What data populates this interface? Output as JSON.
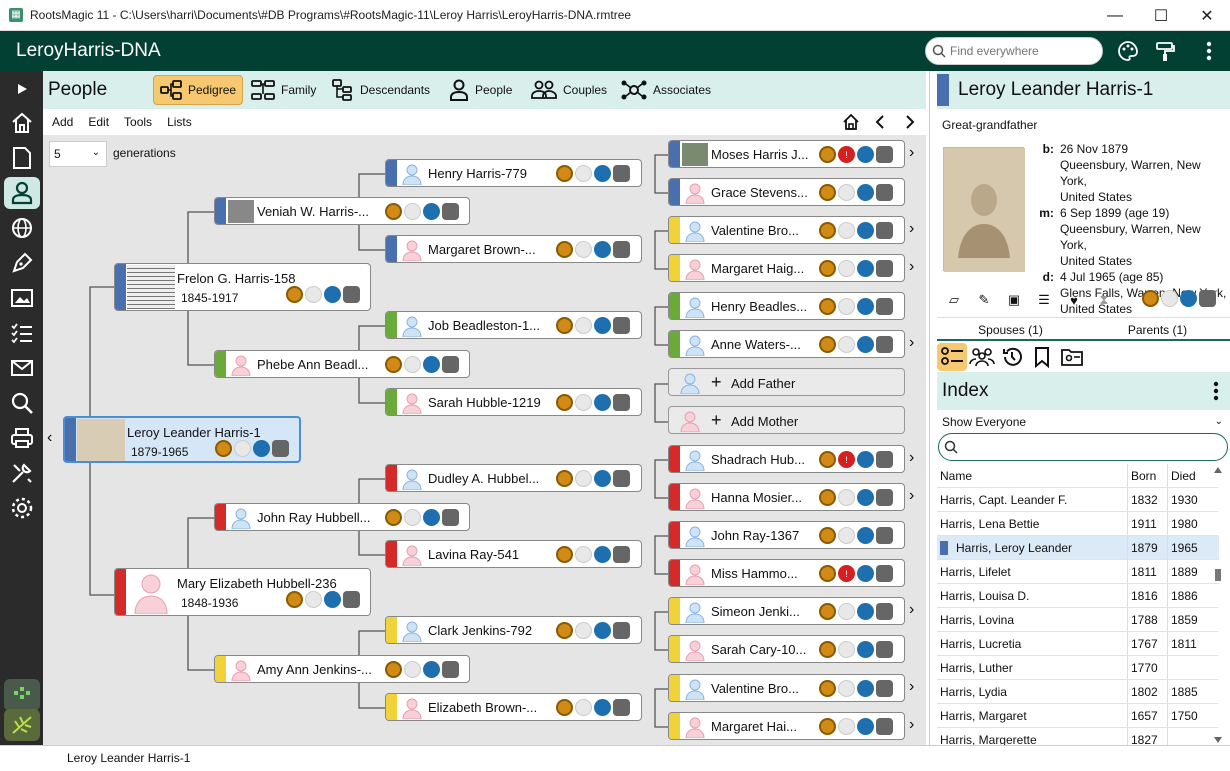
{
  "window": {
    "title": "RootsMagic 11 - C:\\Users\\harri\\Documents\\#DB Programs\\#RootsMagic-11\\Leroy Harris\\LeroyHarris-DNA.rmtree"
  },
  "header": {
    "file_name": "LeroyHarris-DNA",
    "search_placeholder": "Find everywhere"
  },
  "people": {
    "title": "People",
    "views": [
      "Pedigree",
      "Family",
      "Descendants",
      "People",
      "Couples",
      "Associates"
    ],
    "menu": [
      "Add",
      "Edit",
      "Tools",
      "Lists"
    ],
    "generations_value": "5",
    "generations_label": "generations"
  },
  "pedigree": {
    "root": {
      "name": "Leroy Leander Harris-1",
      "years": "1879-1965"
    },
    "father": {
      "name": "Frelon G. Harris-158",
      "years": "1845-1917"
    },
    "mother": {
      "name": "Mary Elizabeth Hubbell-236",
      "years": "1848-1936"
    },
    "g2": [
      "Veniah W. Harris-...",
      "Phebe Ann Beadl...",
      "John Ray Hubbell...",
      "Amy Ann Jenkins-..."
    ],
    "g3": [
      "Henry Harris-779",
      "Margaret Brown-...",
      "Job Beadleston-1...",
      "Sarah Hubble-1219",
      "Dudley A. Hubbel...",
      "Lavina Ray-541",
      "Clark Jenkins-792",
      "Elizabeth Brown-..."
    ],
    "g4": [
      "Moses Harris J...",
      "Grace Stevens...",
      "Valentine Bro...",
      "Margaret Haig...",
      "Henry Beadles...",
      "Anne Waters-...",
      "Add Father",
      "Add Mother",
      "Shadrach Hub...",
      "Hanna Mosier...",
      "John Ray-1367",
      "Miss Hammo...",
      "Simeon Jenki...",
      "Sarah Cary-10...",
      "Valentine Bro...",
      "Margaret Hai..."
    ]
  },
  "detail": {
    "name": "Leroy Leander Harris-1",
    "relationship": "Great-grandfather",
    "facts": [
      {
        "label": "b:",
        "lines": [
          "26 Nov 1879",
          "Queensbury, Warren, New York,",
          "United States"
        ]
      },
      {
        "label": "m:",
        "lines": [
          "6 Sep 1899 (age 19)",
          "Queensbury, Warren, New York,",
          "United States"
        ]
      },
      {
        "label": "d:",
        "lines": [
          "4 Jul 1965 (age 85)",
          "Glens Falls, Warren, New York,",
          "United States"
        ]
      }
    ],
    "spouses_tab": "Spouses (1)",
    "parents_tab": "Parents (1)"
  },
  "index": {
    "title": "Index",
    "filter": "Show Everyone",
    "columns": [
      "Name",
      "Born",
      "Died"
    ],
    "rows": [
      {
        "name": "Harris, Capt. Leander F.",
        "born": "1832",
        "died": "1930"
      },
      {
        "name": "Harris, Lena Bettie",
        "born": "1911",
        "died": "1980"
      },
      {
        "name": "Harris, Leroy Leander",
        "born": "1879",
        "died": "1965"
      },
      {
        "name": "Harris, Lifelet",
        "born": "1811",
        "died": "1889"
      },
      {
        "name": "Harris, Louisa D.",
        "born": "1816",
        "died": "1886"
      },
      {
        "name": "Harris, Lovina",
        "born": "1788",
        "died": "1859"
      },
      {
        "name": "Harris, Lucretia",
        "born": "1767",
        "died": "1811"
      },
      {
        "name": "Harris, Luther",
        "born": "1770",
        "died": ""
      },
      {
        "name": "Harris, Lydia",
        "born": "1802",
        "died": "1885"
      },
      {
        "name": "Harris, Margaret",
        "born": "1657",
        "died": "1750"
      },
      {
        "name": "Harris, Margerette",
        "born": "1827",
        "died": ""
      }
    ]
  },
  "status": {
    "text": "Leroy Leander Harris-1"
  },
  "colors": {
    "header": "#034034",
    "male": "#4a6fae",
    "female": "#d42a2a",
    "green": "#6aaa3a",
    "yellow": "#f0d23a",
    "active_tab": "#f6c870"
  }
}
